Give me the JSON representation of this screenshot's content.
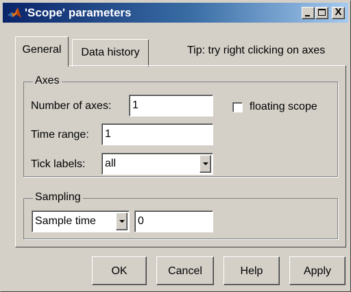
{
  "window": {
    "title": "'Scope' parameters",
    "title_icon": "matlab-membrane-icon"
  },
  "title_buttons": {
    "minimize_icon": "minimize-icon",
    "maximize_icon": "maximize-icon",
    "close_label": "X"
  },
  "tabs": [
    {
      "label": "General",
      "selected": true
    },
    {
      "label": "Data history",
      "selected": false
    }
  ],
  "tip": "Tip: try right clicking on axes",
  "axes_group": {
    "title": "Axes",
    "number_of_axes_label": "Number of axes:",
    "number_of_axes_value": "1",
    "floating_scope_label": "floating scope",
    "floating_scope_checked": false,
    "time_range_label": "Time range:",
    "time_range_value": "1",
    "tick_labels_label": "Tick labels:",
    "tick_labels_value": "all"
  },
  "sampling_group": {
    "title": "Sampling",
    "mode_value": "Sample time",
    "value": "0"
  },
  "buttons": {
    "ok": "OK",
    "cancel": "Cancel",
    "help": "Help",
    "apply": "Apply"
  },
  "colors": {
    "dialog_face": "#d4d0c8",
    "titlebar_start": "#0a246a",
    "titlebar_end": "#a6caf0"
  }
}
